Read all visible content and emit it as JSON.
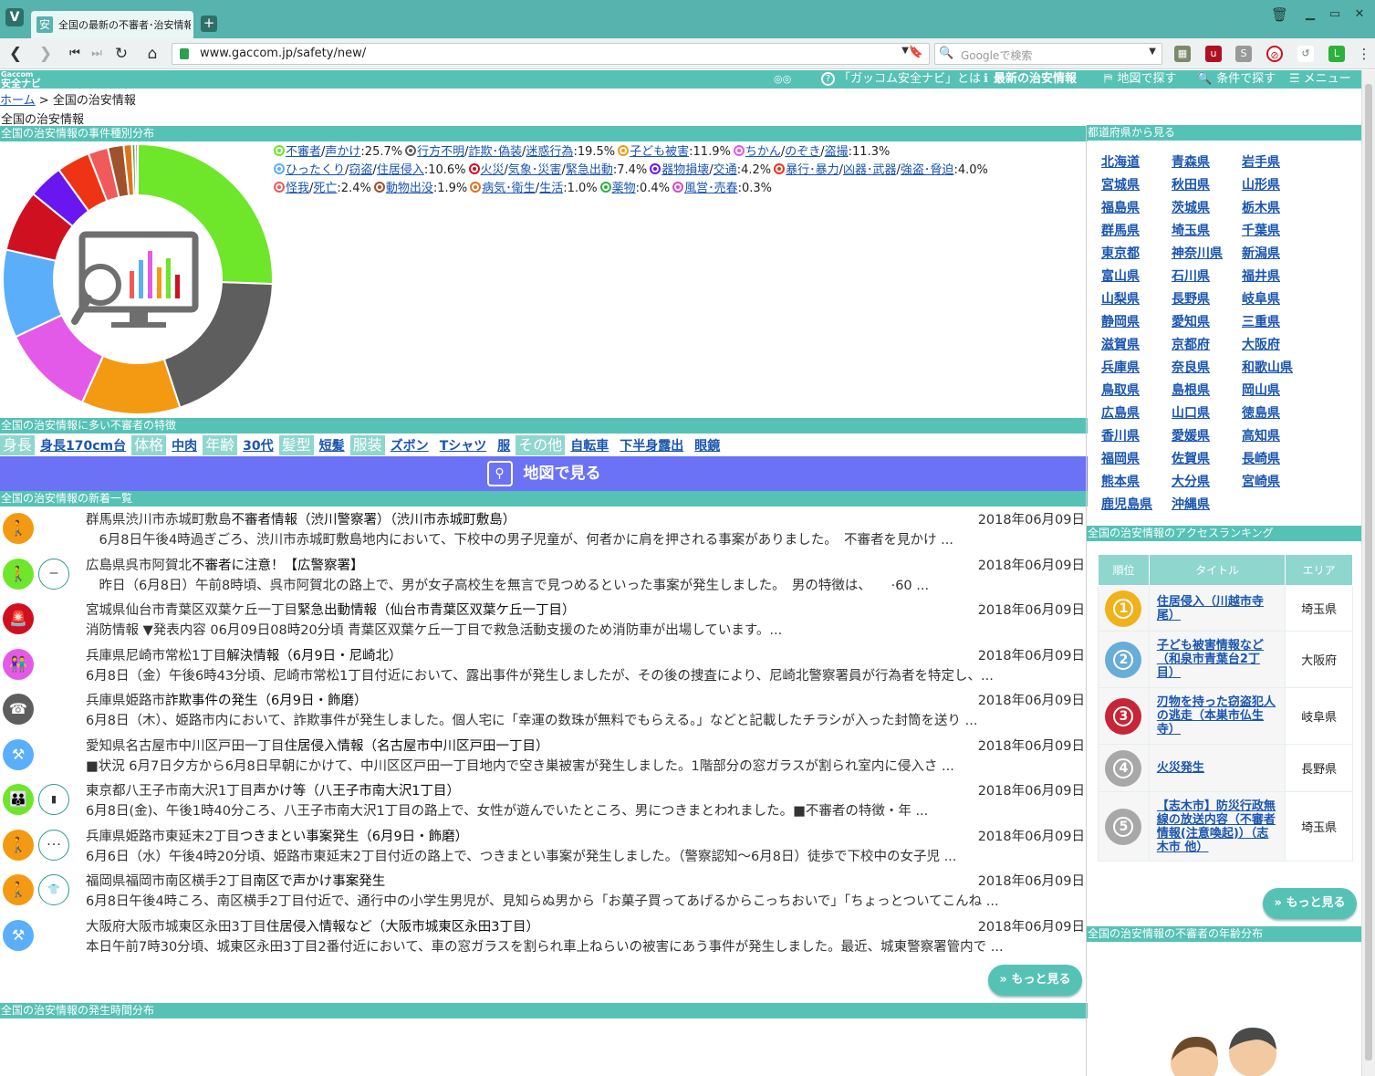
{
  "browser": {
    "tab_title": "全国の最新の不審者･治安情報",
    "tab_favicon": "安",
    "url": "www.gaccom.jp/safety/new/",
    "search_placeholder": "Googleで検索"
  },
  "site": {
    "logo_line1": "Gaccom",
    "logo_line2": "安全ナビ",
    "nav": [
      {
        "icon": "question-icon",
        "label": "「ガッコム安全ナビ」とは"
      },
      {
        "icon": "info-icon",
        "label": "最新の治安情報"
      },
      {
        "icon": "map-icon",
        "label": "地図で探す"
      },
      {
        "icon": "search-icon",
        "label": "条件で探す"
      },
      {
        "icon": "menu-icon",
        "label": "メニュー"
      }
    ]
  },
  "breadcrumb": {
    "home": "ホーム",
    "sep": ">",
    "current": "全国の治安情報"
  },
  "page_title": "全国の治安情報",
  "sections": {
    "distribution": "全国の治安情報の事件種別分布",
    "traits": "全国の治安情報に多い不審者の特徴",
    "news": "全国の治安情報の新着一覧",
    "time": "全国の治安情報の発生時間分布",
    "prefectures": "都道府県から見る",
    "ranking": "全国の治安情報のアクセスランキング",
    "age": "全国の治安情報の不審者の年齢分布"
  },
  "chart_data": {
    "type": "pie",
    "categories": [
      "不審者/声かけ",
      "行方不明/詐欺･偽装/迷惑行為",
      "子ども被害",
      "ちかん/のぞき/盗撮",
      "ひったくり/窃盗/住居侵入",
      "火災/気象･災害/緊急出動",
      "器物損壊/交通",
      "暴行･暴力/凶器･武器/強盗･脅迫",
      "怪我/死亡",
      "動物出没",
      "病気･衛生/生活",
      "薬物",
      "風営･売春"
    ],
    "values": [
      25.7,
      19.5,
      11.9,
      11.3,
      10.6,
      7.4,
      4.2,
      4.0,
      2.4,
      1.9,
      1.0,
      0.4,
      0.3
    ],
    "unit": "%",
    "colors": [
      "#6ee62a",
      "#5e5e5e",
      "#f39a12",
      "#e45ae8",
      "#5aaefa",
      "#cf1020",
      "#6a16f0",
      "#ef3416",
      "#f05a5a",
      "#a0522d",
      "#e0741c",
      "#30b040",
      "#d44cc8"
    ]
  },
  "legend": [
    {
      "parts": [
        "不審者",
        "声かけ"
      ],
      "value": "25.7%",
      "color": "#6ee62a"
    },
    {
      "parts": [
        "行方不明",
        "詐欺･偽装",
        "迷惑行為"
      ],
      "value": "19.5%",
      "color": "#5e5e5e"
    },
    {
      "parts": [
        "子ども被害"
      ],
      "value": "11.9%",
      "color": "#f39a12"
    },
    {
      "parts": [
        "ちかん",
        "のぞき",
        "盗撮"
      ],
      "value": "11.3%",
      "color": "#e45ae8"
    },
    {
      "parts": [
        "ひったくり",
        "窃盗",
        "住居侵入"
      ],
      "value": "10.6%",
      "color": "#5aaefa"
    },
    {
      "parts": [
        "火災",
        "気象･災害",
        "緊急出動"
      ],
      "value": "7.4%",
      "color": "#cf1020"
    },
    {
      "parts": [
        "器物損壊",
        "交通"
      ],
      "value": "4.2%",
      "color": "#6a16f0"
    },
    {
      "parts": [
        "暴行･暴力",
        "凶器･武器",
        "強盗･脅迫"
      ],
      "value": "4.0%",
      "color": "#ef3416"
    },
    {
      "parts": [
        "怪我",
        "死亡"
      ],
      "value": "2.4%",
      "color": "#f05a5a"
    },
    {
      "parts": [
        "動物出没"
      ],
      "value": "1.9%",
      "color": "#a0522d"
    },
    {
      "parts": [
        "病気･衛生",
        "生活"
      ],
      "value": "1.0%",
      "color": "#e0741c"
    },
    {
      "parts": [
        "薬物"
      ],
      "value": "0.4%",
      "color": "#30b040"
    },
    {
      "parts": [
        "風営･売春"
      ],
      "value": "0.3%",
      "color": "#d44cc8"
    }
  ],
  "traits": [
    {
      "label": "身長",
      "values": [
        "身長170cm台"
      ]
    },
    {
      "label": "体格",
      "values": [
        "中肉"
      ]
    },
    {
      "label": "年齢",
      "values": [
        "30代"
      ]
    },
    {
      "label": "髪型",
      "values": [
        "短髪"
      ]
    },
    {
      "label": "服装",
      "values": [
        "ズボン",
        "Tシャツ",
        "服"
      ]
    },
    {
      "label": "その他",
      "values": [
        "自転車",
        "下半身露出",
        "眼鏡"
      ]
    }
  ],
  "map_button": "地図で見る",
  "news": [
    {
      "place": "群馬県渋川市赤城町敷島",
      "title": "不審者情報（渋川警察署）（渋川市赤城町敷島）",
      "date": "2018年06月09日",
      "body": "　6月8日午後4時過ぎごろ、渋川市赤城町敷島地内において、下校中の男子児童が、何者かに肩を押される事案がありました。　不審者を見かけ ...",
      "icon_color": "#f39a12",
      "icon": "🚶",
      "icon2": ""
    },
    {
      "place": "広島県呉市阿賀北",
      "title": "不審者に注意！【広警察署】",
      "date": "2018年06月09日",
      "body": "　昨日（6月8日）午前8時頃、呉市阿賀北の路上で、男が女子高校生を無言で見つめるといった事案が発生しました。　男の特徴は、　　·60 ...",
      "icon_color": "#6ee62a",
      "icon": "🚶",
      "icon2": "ー"
    },
    {
      "place": "宮城県仙台市青葉区双葉ケ丘一丁目",
      "title": "緊急出動情報（仙台市青葉区双葉ケ丘一丁目）",
      "date": "2018年06月09日",
      "body": "消防情報 ▼発表内容 06月09日08時20分頃 青葉区双葉ケ丘一丁目で救急活動支援のため消防車が出場しています。...",
      "icon_color": "#cf1020",
      "icon": "🚨",
      "icon2": ""
    },
    {
      "place": "兵庫県尼崎市常松1丁目",
      "title": "解決情報（6月9日・尼崎北）",
      "date": "2018年06月09日",
      "body": "6月8日（金）午後6時43分頃、尼崎市常松1丁目付近において、露出事件が発生しましたが、その後の捜査により、尼崎北警察署員が行為者を特定し、...",
      "icon_color": "#e45ae8",
      "icon": "👫",
      "icon2": ""
    },
    {
      "place": "兵庫県姫路市",
      "title": "詐欺事件の発生（6月9日・飾磨）",
      "date": "2018年06月09日",
      "body": "6月8日（木）、姫路市内において、詐欺事件が発生しました。個人宅に「幸運の数珠が無料でもらえる。」などと記載したチラシが入った封筒を送り ...",
      "icon_color": "#5e5e5e",
      "icon": "☎",
      "icon2": ""
    },
    {
      "place": "愛知県名古屋市中川区戸田一丁目",
      "title": "住居侵入情報（名古屋市中川区戸田一丁目）",
      "date": "2018年06月09日",
      "body": "■状況 6月7日夕方から6月8日早朝にかけて、中川区区戸田一丁目地内で空き巣被害が発生しました。1階部分の窓ガラスが割られ室内に侵入さ ...",
      "icon_color": "#5aaefa",
      "icon": "⚒",
      "icon2": ""
    },
    {
      "place": "東京都八王子市南大沢1丁目",
      "title": "声かけ等（八王子市南大沢1丁目）",
      "date": "2018年06月09日",
      "body": "6月8日(金)、午後1時40分ころ、八王子市南大沢1丁目の路上で、女性が遊んでいたところ、男につきまとわれました。■不審者の特徴・年 ...",
      "icon_color": "#6ee62a",
      "icon": "👪",
      "icon2": "▮"
    },
    {
      "place": "兵庫県姫路市東延末2丁目",
      "title": "つきまとい事案発生（6月9日・飾磨）",
      "date": "2018年06月09日",
      "body": "6月6日（水）午後4時20分頃、姫路市東延末2丁目付近の路上で、つきまとい事案が発生しました。（警察認知～6月8日）徒歩で下校中の女子児 ...",
      "icon_color": "#f39a12",
      "icon": "🚶",
      "icon2": "･･･"
    },
    {
      "place": "福岡県福岡市南区横手2丁目",
      "title": "南区で声かけ事案発生",
      "date": "2018年06月09日",
      "body": "6月8日午後4時ころ、南区横手2丁目付近で、通行中の小学生男児が、見知らぬ男から「お菓子買ってあげるからこっちおいで」「ちょっとついてこんね ...",
      "icon_color": "#f39a12",
      "icon": "🚶",
      "icon2": "👕"
    },
    {
      "place": "大阪府大阪市城東区永田3丁目",
      "title": "住居侵入情報など（大阪市城東区永田3丁目）",
      "date": "2018年06月09日",
      "body": "本日午前7時30分頃、城東区永田3丁目2番付近において、車の窓ガラスを割られ車上ねらいの被害にあう事件が発生しました。最近、城東警察署管内で ...",
      "icon_color": "#5aaefa",
      "icon": "⚒",
      "icon2": ""
    }
  ],
  "more_label": "» もっと見る",
  "prefectures": [
    "北海道",
    "青森県",
    "岩手県",
    "宮城県",
    "秋田県",
    "山形県",
    "福島県",
    "茨城県",
    "栃木県",
    "群馬県",
    "埼玉県",
    "千葉県",
    "東京都",
    "神奈川県",
    "新潟県",
    "富山県",
    "石川県",
    "福井県",
    "山梨県",
    "長野県",
    "岐阜県",
    "静岡県",
    "愛知県",
    "三重県",
    "滋賀県",
    "京都府",
    "大阪府",
    "兵庫県",
    "奈良県",
    "和歌山県",
    "鳥取県",
    "島根県",
    "岡山県",
    "広島県",
    "山口県",
    "徳島県",
    "香川県",
    "愛媛県",
    "高知県",
    "福岡県",
    "佐賀県",
    "長崎県",
    "熊本県",
    "大分県",
    "宮崎県",
    "鹿児島県",
    "沖縄県"
  ],
  "ranking": {
    "headers": [
      "順位",
      "タイトル",
      "エリア"
    ],
    "rows": [
      {
        "rank": "1",
        "title": "住居侵入（川越市寺尾）",
        "area": "埼玉県",
        "color": "#f0b21a"
      },
      {
        "rank": "2",
        "title": "子ども被害情報など（和泉市青葉台2丁目）",
        "area": "大阪府",
        "color": "#68acd8"
      },
      {
        "rank": "3",
        "title": "刃物を持った窃盗犯人の逃走（本巣市仏生寺）",
        "area": "岐阜県",
        "color": "#c62638"
      },
      {
        "rank": "4",
        "title": "火災発生",
        "area": "長野県",
        "color": "#a8a8a8"
      },
      {
        "rank": "5",
        "title": "【志木市】防災行政無線の放送内容（不審者情報(注意喚起)）（志木市 他）",
        "area": "埼玉県",
        "color": "#a8a8a8"
      }
    ]
  }
}
